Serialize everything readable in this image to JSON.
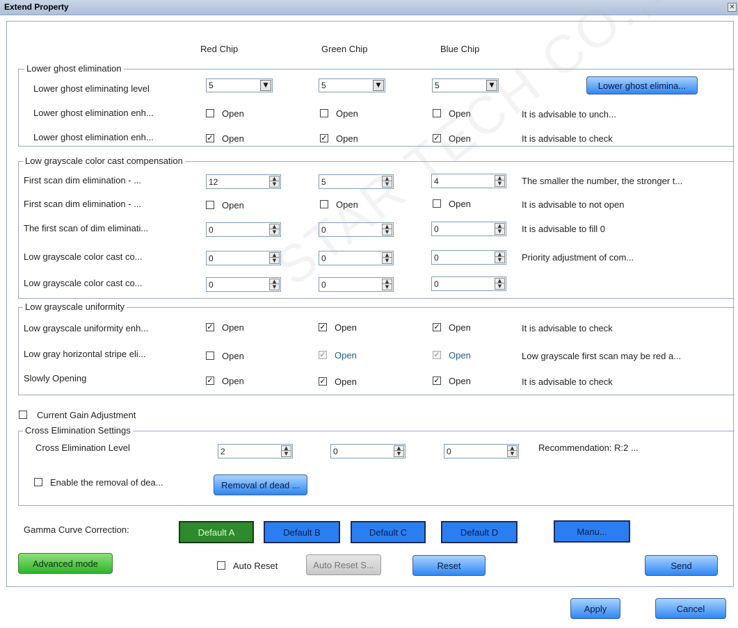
{
  "window": {
    "title": "Extend Property",
    "close_glyph": "✕"
  },
  "columns": {
    "red": "Red Chip",
    "green": "Green Chip",
    "blue": "Blue Chip"
  },
  "lower_ghost": {
    "legend": "Lower ghost elimination",
    "level_label": "Lower ghost eliminating level",
    "level_red": "5",
    "level_green": "5",
    "level_blue": "5",
    "button": "Lower ghost elimina...",
    "enh1_label": "Lower ghost elimination enh...",
    "enh1_note": "It is advisable to unch...",
    "enh2_label": "Lower ghost elimination enh...",
    "enh2_note": "It is advisable to check"
  },
  "open_label": "Open",
  "check_glyph": "✓",
  "compensation": {
    "legend": "Low grayscale color cast compensation",
    "row1_label": "First scan dim elimination - ...",
    "row1_red": "12",
    "row1_green": "5",
    "row1_blue": "4",
    "row1_note": "The smaller the number, the stronger t...",
    "row2_label": "First scan dim elimination - ...",
    "row2_note": "It is advisable to not open",
    "row3_label": "The first scan of dim eliminati...",
    "row3_red": "0",
    "row3_green": "0",
    "row3_blue": "0",
    "row3_note": "It is advisable to fill 0",
    "row4_label": "Low grayscale color cast co...",
    "row4_red": "0",
    "row4_green": "0",
    "row4_blue": "0",
    "row4_note": "Priority adjustment of com...",
    "row5_label": "Low grayscale color cast co...",
    "row5_red": "0",
    "row5_green": "0",
    "row5_blue": "0"
  },
  "uniformity": {
    "legend": "Low grayscale uniformity",
    "row1_label": "Low grayscale uniformity enh...",
    "row1_note": "It is advisable to check",
    "row2_label": "Low gray horizontal stripe eli...",
    "row2_note": "Low grayscale first scan may be red a...",
    "row3_label": "Slowly Opening",
    "row3_note": "It is advisable to check"
  },
  "current_gain": {
    "label": "Current Gain Adjustment"
  },
  "cross": {
    "legend": "Cross Elimination Settings",
    "level_label": "Cross Elimination Level",
    "red": "2",
    "green": "0",
    "blue": "0",
    "note": "Recommendation: R:2 ...",
    "dead_label": "Enable the removal of dea...",
    "dead_button": "Removal of dead ..."
  },
  "gamma": {
    "label": "Gamma Curve Correction:",
    "a": "Default A",
    "b": "Default B",
    "c": "Default C",
    "d": "Default D",
    "manu": "Manu..."
  },
  "bottom": {
    "advanced": "Advanced mode",
    "auto_reset": "Auto Reset",
    "auto_reset_s": "Auto Reset S...",
    "reset": "Reset",
    "send": "Send"
  },
  "footer": {
    "apply": "Apply",
    "cancel": "Cancel"
  },
  "watermark": "STAR TECH CO.,LTD."
}
